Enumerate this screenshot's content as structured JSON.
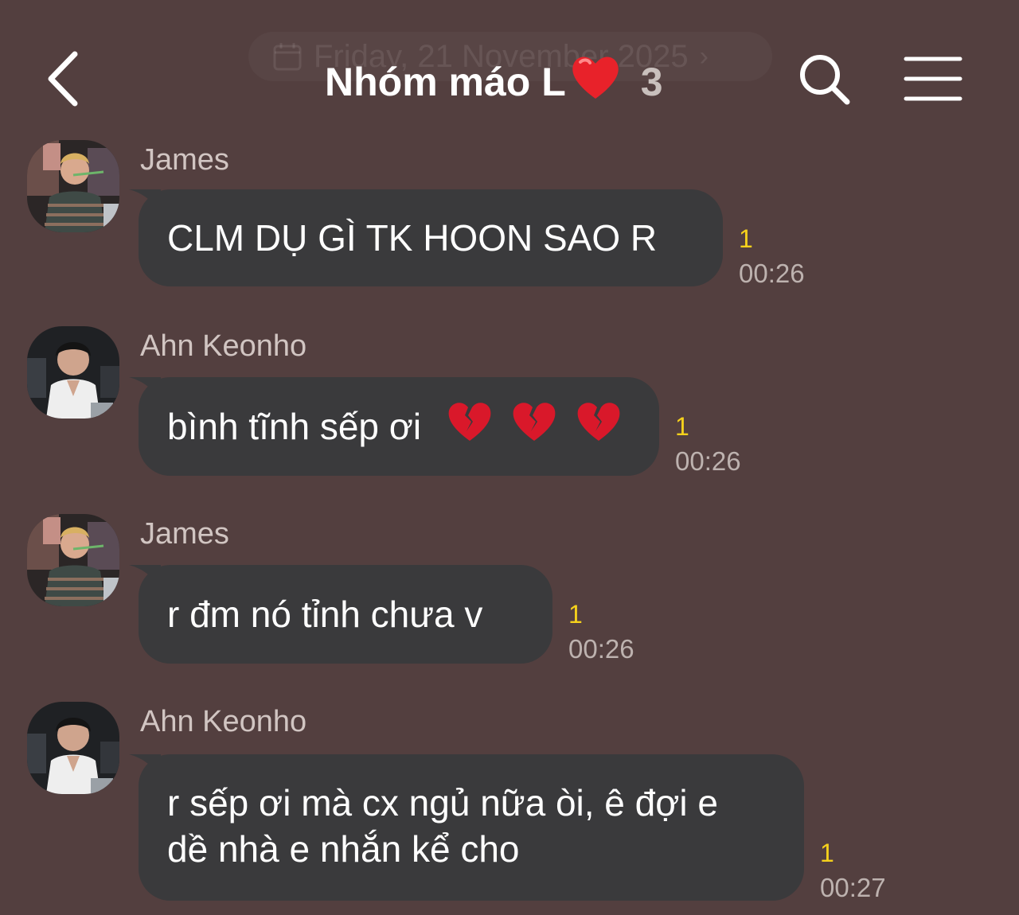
{
  "header": {
    "title": "Nhóm máo L",
    "title_emoji": "red-heart",
    "member_count": "3",
    "date_pill": "Friday, 21 November 2025"
  },
  "messages": [
    {
      "sender": "James",
      "text": "CLM DỤ GÌ TK HOON SAO R",
      "unread": "1",
      "time": "00:26",
      "avatar": "avatar-james"
    },
    {
      "sender": "Ahn Keonho",
      "text": "bình tĩnh sếp ơi",
      "emojis": [
        "broken-heart",
        "broken-heart",
        "broken-heart"
      ],
      "unread": "1",
      "time": "00:26",
      "avatar": "avatar-keonho"
    },
    {
      "sender": "James",
      "text": "r đm nó tỉnh chưa v",
      "unread": "1",
      "time": "00:26",
      "avatar": "avatar-james"
    },
    {
      "sender": "Ahn Keonho",
      "text_lines": [
        "r sếp ơi mà cx ngủ nữa òi, ê đợi e",
        "dề nhà e nhắn kể cho"
      ],
      "unread": "1",
      "time": "00:27",
      "avatar": "avatar-keonho"
    }
  ],
  "colors": {
    "background": "#533f3f",
    "bubble": "#3a3a3c",
    "unread": "#f5d11c",
    "time": "#bdb2af",
    "sender": "#d1c5c2"
  }
}
